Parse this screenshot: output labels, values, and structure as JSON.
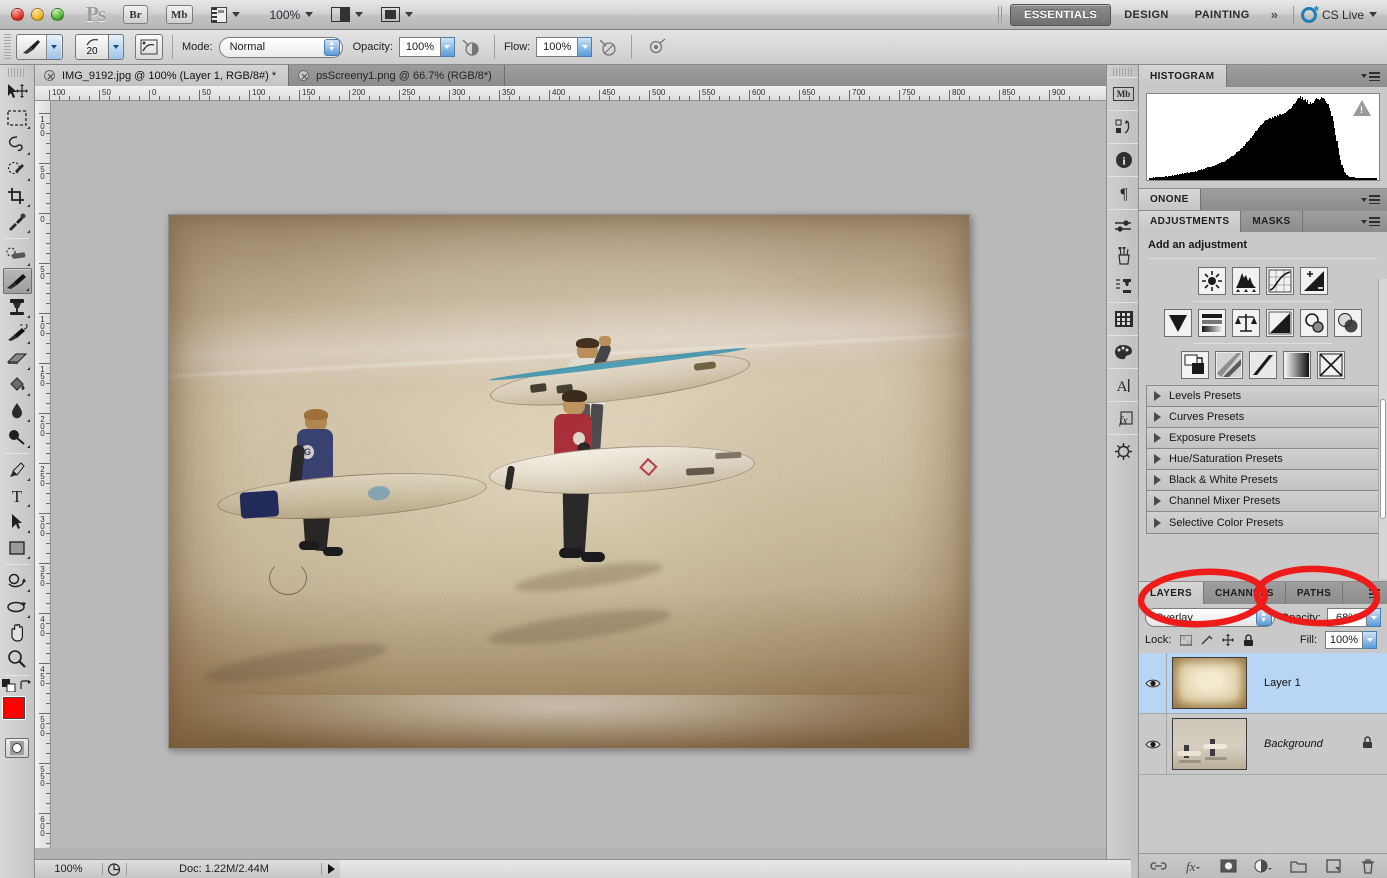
{
  "titlebar": {
    "app_name": "Ps",
    "bridge_button": "Br",
    "minibridge_button": "Mb",
    "zoom_level": "100%",
    "workspaces": [
      {
        "label": "ESSENTIALS",
        "active": true
      },
      {
        "label": "DESIGN",
        "active": false
      },
      {
        "label": "PAINTING",
        "active": false
      }
    ],
    "more_workspaces": "»",
    "cs_live": "CS Live"
  },
  "options_bar": {
    "brush_size": "20",
    "mode_label": "Mode:",
    "mode_value": "Normal",
    "opacity_label": "Opacity:",
    "opacity_value": "100%",
    "flow_label": "Flow:",
    "flow_value": "100%"
  },
  "document_tabs": [
    {
      "title": "IMG_9192.jpg @ 100% (Layer 1, RGB/8#) *",
      "active": true
    },
    {
      "title": "psScreeny1.png @ 66.7% (RGB/8*)",
      "active": false
    }
  ],
  "toolbox": {
    "tools": [
      {
        "name": "move-tool",
        "selected": false
      },
      {
        "name": "rectangular-marquee-tool",
        "selected": false
      },
      {
        "name": "lasso-tool",
        "selected": false
      },
      {
        "name": "quick-selection-tool",
        "selected": false
      },
      {
        "name": "crop-tool",
        "selected": false
      },
      {
        "name": "eyedropper-tool",
        "selected": false
      },
      {
        "name": "spot-healing-brush-tool",
        "selected": false
      },
      {
        "name": "brush-tool",
        "selected": true
      },
      {
        "name": "clone-stamp-tool",
        "selected": false
      },
      {
        "name": "history-brush-tool",
        "selected": false
      },
      {
        "name": "eraser-tool",
        "selected": false
      },
      {
        "name": "gradient-tool",
        "selected": false
      },
      {
        "name": "blur-tool",
        "selected": false
      },
      {
        "name": "dodge-tool",
        "selected": false
      },
      {
        "name": "pen-tool",
        "selected": false
      },
      {
        "name": "horizontal-type-tool",
        "selected": false
      },
      {
        "name": "path-selection-tool",
        "selected": false
      },
      {
        "name": "rectangle-tool",
        "selected": false
      },
      {
        "name": "rotate-3d-tool",
        "selected": false
      },
      {
        "name": "orbit-3d-camera-tool",
        "selected": false
      },
      {
        "name": "hand-tool",
        "selected": false
      },
      {
        "name": "zoom-tool",
        "selected": false
      }
    ],
    "foreground_color": "#ff0000",
    "background_color": "#000000"
  },
  "rulers": {
    "unit": "pixels",
    "horizontal_labels": [
      "100",
      "50",
      "0",
      "50",
      "100",
      "150",
      "200",
      "250",
      "300",
      "350",
      "400",
      "450",
      "500",
      "550",
      "600",
      "650",
      "700",
      "750",
      "800",
      "850",
      "900"
    ],
    "vertical_labels": [
      "100",
      "50",
      "0",
      "50",
      "100",
      "150",
      "200",
      "250",
      "300",
      "350",
      "400",
      "450",
      "500",
      "550",
      "600"
    ]
  },
  "canvas": {
    "image_title": "Surfers on the beach with vintage texture overlay",
    "surfer_count": 3
  },
  "panels": {
    "histogram": {
      "tab": "HISTOGRAM",
      "warning": true,
      "bins": [
        2,
        2,
        2,
        3,
        2,
        3,
        3,
        3,
        4,
        3,
        4,
        4,
        4,
        5,
        4,
        5,
        5,
        5,
        6,
        5,
        6,
        6,
        7,
        6,
        7,
        7,
        8,
        7,
        8,
        8,
        9,
        8,
        9,
        9,
        10,
        10,
        11,
        10,
        11,
        12,
        12,
        13,
        12,
        13,
        14,
        14,
        15,
        15,
        16,
        16,
        17,
        17,
        18,
        18,
        19,
        20,
        20,
        21,
        22,
        22,
        23,
        24,
        25,
        26,
        27,
        28,
        29,
        30,
        31,
        33,
        34,
        35,
        37,
        38,
        40,
        41,
        43,
        45,
        46,
        48,
        50,
        52,
        54,
        56,
        58,
        60,
        62,
        63,
        65,
        67,
        68,
        70,
        71,
        72,
        73,
        74,
        73,
        75,
        74,
        76,
        75,
        77,
        76,
        78,
        77,
        79,
        78,
        80,
        81,
        82,
        83,
        85,
        86,
        88,
        90,
        92,
        94,
        96,
        98,
        100,
        96,
        99,
        95,
        97,
        93,
        95,
        91,
        93,
        90,
        92,
        94,
        96,
        98,
        97,
        95,
        97,
        99,
        98,
        96,
        94,
        92,
        90,
        86,
        82,
        76,
        70,
        62,
        54,
        46,
        38,
        30,
        24,
        18,
        14,
        10,
        8,
        6,
        5,
        4,
        4,
        3,
        3,
        3,
        2,
        2,
        2,
        2,
        2,
        2,
        2,
        2,
        2,
        2,
        2,
        2,
        2,
        2,
        2,
        2,
        2
      ]
    },
    "onone": {
      "tab": "ONONE"
    },
    "adjustments": {
      "tabs": [
        {
          "label": "ADJUSTMENTS",
          "active": true
        },
        {
          "label": "MASKS",
          "active": false
        }
      ],
      "heading": "Add an adjustment",
      "icons_row1": [
        "brightness-contrast-icon",
        "levels-icon",
        "curves-icon",
        "exposure-icon"
      ],
      "icons_row2": [
        "vibrance-icon",
        "hue-saturation-icon",
        "color-balance-icon",
        "black-white-icon",
        "photo-filter-icon",
        "channel-mixer-icon"
      ],
      "icons_row3": [
        "invert-icon",
        "posterize-icon",
        "threshold-icon",
        "gradient-map-icon",
        "selective-color-icon"
      ],
      "presets": [
        "Levels Presets",
        "Curves Presets",
        "Exposure Presets",
        "Hue/Saturation Presets",
        "Black & White Presets",
        "Channel Mixer Presets",
        "Selective Color Presets"
      ]
    },
    "layers": {
      "tabs": [
        {
          "label": "LAYERS",
          "active": true
        },
        {
          "label": "CHANNELS",
          "active": false
        },
        {
          "label": "PATHS",
          "active": false
        }
      ],
      "blend_mode": "Overlay",
      "opacity_label": "Opacity:",
      "opacity_value": "68%",
      "lock_label": "Lock:",
      "fill_label": "Fill:",
      "fill_value": "100%",
      "rows": [
        {
          "name": "Layer 1",
          "selected": true,
          "locked": false,
          "visible": true,
          "thumb": "paper-texture"
        },
        {
          "name": "Background",
          "selected": false,
          "locked": true,
          "visible": true,
          "thumb": "beach-photo"
        }
      ],
      "footer_buttons": [
        "link-layers-icon",
        "layer-style-fx-icon",
        "add-layer-mask-icon",
        "new-adjustment-layer-icon",
        "new-group-icon",
        "new-layer-icon",
        "delete-layer-icon"
      ]
    }
  },
  "status_bar": {
    "zoom": "100%",
    "doc_info": "Doc: 1.22M/2.44M"
  },
  "annotations": {
    "color": "#ee1b1b",
    "ellipses": [
      {
        "name": "blend-mode-highlight",
        "target": "Overlay blend mode dropdown"
      },
      {
        "name": "opacity-highlight",
        "target": "Opacity 68% field"
      }
    ]
  }
}
